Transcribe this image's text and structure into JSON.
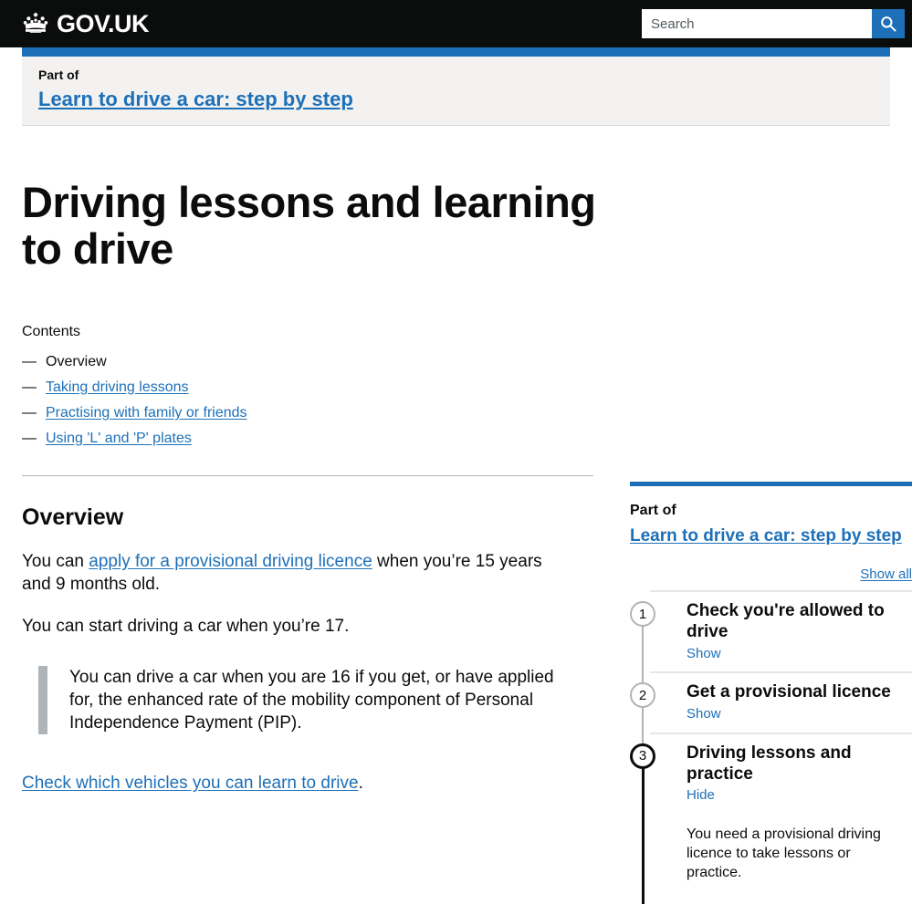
{
  "header": {
    "brand_name": "GOV.UK",
    "crown_icon": "crown-icon",
    "search_placeholder": "Search",
    "search_value": "",
    "search_icon": "search-icon"
  },
  "partof_banner": {
    "label": "Part of",
    "link_text": "Learn to drive a car: step by step"
  },
  "page": {
    "title": "Driving lessons and learning to drive"
  },
  "contents": {
    "heading": "Contents",
    "dash": "—",
    "items": [
      {
        "label": "Overview",
        "current": true
      },
      {
        "label": "Taking driving lessons",
        "current": false
      },
      {
        "label": "Practising with family or friends",
        "current": false
      },
      {
        "label": "Using 'L' and 'P' plates",
        "current": false
      }
    ]
  },
  "main": {
    "section_heading": "Overview",
    "para1_before": "You can ",
    "para1_link": "apply for a provisional driving licence",
    "para1_after": " when you’re 15 years and 9 months old.",
    "para2": "You can start driving a car when you’re 17.",
    "inset": "You can drive a car when you are 16 if you get, or have applied for, the enhanced rate of the mobility component of Personal Independence Payment (PIP).",
    "para3_link": "Check which vehicles you can learn to drive",
    "para3_after": "."
  },
  "sidebar": {
    "label": "Part of",
    "title_link": "Learn to drive a car: step by step",
    "show_all": "Show all",
    "steps": [
      {
        "number": "1",
        "title": "Check you're allowed to drive",
        "toggle": "Show",
        "expanded": false,
        "body": ""
      },
      {
        "number": "2",
        "title": "Get a provisional licence",
        "toggle": "Show",
        "expanded": false,
        "body": ""
      },
      {
        "number": "3",
        "title": "Driving lessons and practice",
        "toggle": "Hide",
        "expanded": true,
        "body": "You need a provisional driving licence to take lessons or practice."
      }
    ]
  },
  "colors": {
    "brand_black": "#0b0c0c",
    "link_blue": "#1d70b8",
    "banner_grey": "#f3f2f1",
    "border_grey": "#b1b4b6"
  }
}
